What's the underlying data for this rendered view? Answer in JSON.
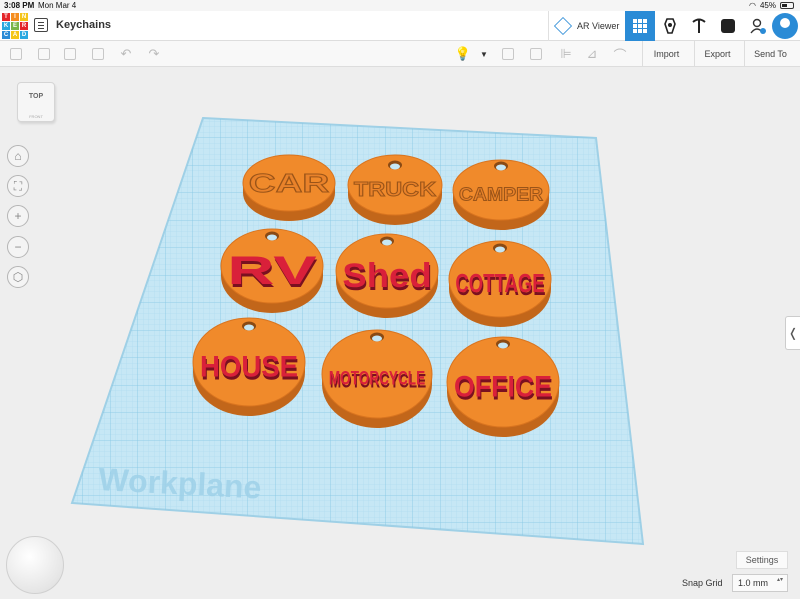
{
  "status_bar": {
    "time": "3:08 PM",
    "date": "Mon Mar 4",
    "battery": "45%"
  },
  "logo": {
    "letters": [
      "T",
      "I",
      "N",
      "K",
      "E",
      "R",
      "C",
      "A",
      "D"
    ],
    "colors": [
      "#e4262a",
      "#f58d1e",
      "#f5c518",
      "#29a9e1",
      "#7ab648",
      "#e4262a",
      "#2a8bd6",
      "#f5c518",
      "#29a9e1"
    ]
  },
  "header": {
    "title": "Keychains",
    "ar_viewer_label": "AR Viewer"
  },
  "toolbar": {
    "import_label": "Import",
    "export_label": "Export",
    "send_to_label": "Send To"
  },
  "viewcube": {
    "top_label": "TOP",
    "front_label": "FRONT"
  },
  "workplane": {
    "label": "Workplane",
    "color": "#bfe3f3",
    "grid_color": "#7fc3e3"
  },
  "keychains": [
    {
      "text": "CAR",
      "style": "engraved"
    },
    {
      "text": "TRUCK",
      "style": "engraved"
    },
    {
      "text": "CAMPER",
      "style": "engraved"
    },
    {
      "text": "RV",
      "style": "raised"
    },
    {
      "text": "Shed",
      "style": "raised"
    },
    {
      "text": "COTTAGE",
      "style": "raised"
    },
    {
      "text": "HOUSE",
      "style": "raised"
    },
    {
      "text": "MOTORCYCLE",
      "style": "raised"
    },
    {
      "text": "OFFICE",
      "style": "raised"
    }
  ],
  "colors": {
    "disc_top": "#f08a2b",
    "disc_side": "#c2661a",
    "raised_text": "#d9203a",
    "accent": "#2a8bd6"
  },
  "footer": {
    "settings_label": "Settings",
    "snap_grid_label": "Snap Grid",
    "snap_grid_value": "1.0 mm"
  }
}
